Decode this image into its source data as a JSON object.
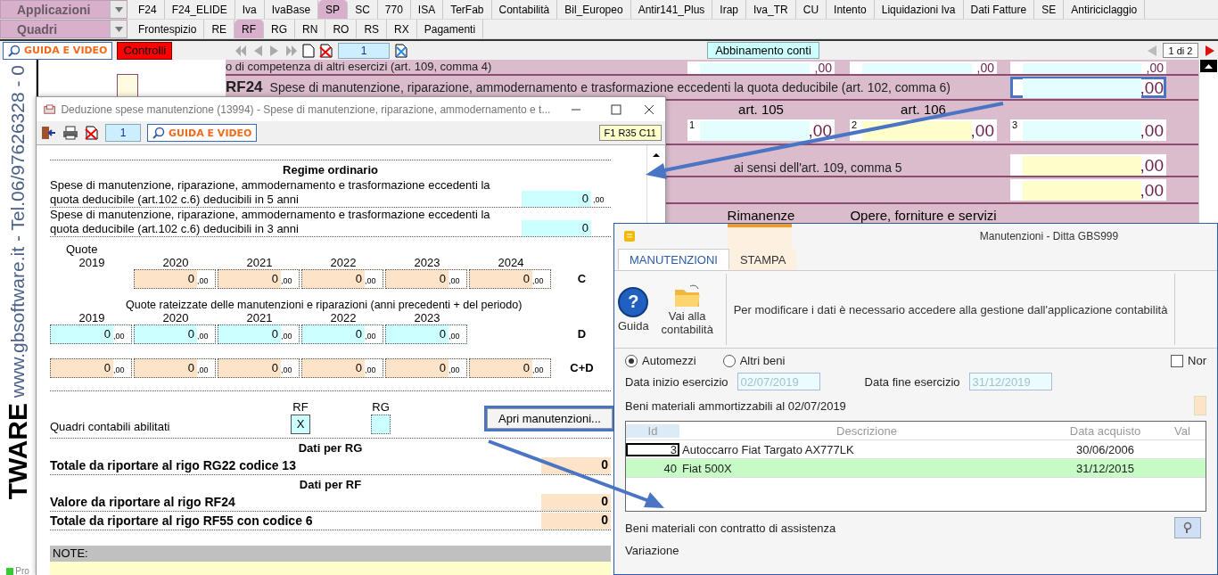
{
  "menu": {
    "applications_label": "Applicazioni",
    "applications": [
      {
        "label": "F24",
        "selected": false
      },
      {
        "label": "F24_ELIDE",
        "selected": false
      },
      {
        "label": "Iva",
        "selected": false
      },
      {
        "label": "IvaBase",
        "selected": false
      },
      {
        "label": "SP",
        "selected": true
      },
      {
        "label": "SC",
        "selected": false
      },
      {
        "label": "770",
        "selected": false
      },
      {
        "label": "ISA",
        "selected": false
      },
      {
        "label": "TerFab",
        "selected": false
      },
      {
        "label": "Contabilità",
        "selected": false
      },
      {
        "label": "Bil_Europeo",
        "selected": false
      },
      {
        "label": "Antir141_Plus",
        "selected": false
      },
      {
        "label": "Irap",
        "selected": false
      },
      {
        "label": "Iva_TR",
        "selected": false
      },
      {
        "label": "CU",
        "selected": false
      },
      {
        "label": "Intento",
        "selected": false
      },
      {
        "label": "Liquidazioni Iva",
        "selected": false
      },
      {
        "label": "Dati Fatture",
        "selected": false
      },
      {
        "label": "SE",
        "selected": false
      },
      {
        "label": "Antiriciclaggio",
        "selected": false
      }
    ],
    "sections_label": "Quadri",
    "sections": [
      {
        "label": "Frontespizio",
        "selected": false
      },
      {
        "label": "RE",
        "selected": false
      },
      {
        "label": "RF",
        "selected": true
      },
      {
        "label": "RG",
        "selected": false
      },
      {
        "label": "RN",
        "selected": false
      },
      {
        "label": "RO",
        "selected": false
      },
      {
        "label": "RS",
        "selected": false
      },
      {
        "label": "RX",
        "selected": false
      },
      {
        "label": "Pagamenti",
        "selected": false
      }
    ]
  },
  "toolbar": {
    "guide_button": "GUIDA E VIDEO",
    "checks_button": "Controlli",
    "page": "1",
    "match_button": "Abbinamento conti",
    "page_count": "1 di 2"
  },
  "sidebar": {
    "banner": "www.gbsoftware.it - Tel.06/97626328 - 0",
    "brand": "TWARE",
    "status": "Pro"
  },
  "form": {
    "top_line": "o di competenza di altri esercizi (art. 109, comma 4)",
    "top_fields": [
      {
        "value": ",00",
        "kind": "input"
      },
      {
        "value": ",00",
        "kind": "input"
      },
      {
        "value": ",00",
        "kind": "input"
      }
    ],
    "rf24_code": "RF24",
    "rf24_text": "Spese di manutenzione, riparazione, ammodernamento e trasformazione eccedenti la quota deducibile (art. 102, comma 6)",
    "rf24_field": {
      "value": ",00",
      "kind": "input"
    },
    "art_labels": [
      "art. 105",
      "art. 106"
    ],
    "art_fields": [
      {
        "index": "1",
        "value": ",00",
        "kind": "input"
      },
      {
        "index": "2",
        "value": ",00",
        "kind": "calculated"
      },
      {
        "index": "3",
        "value": ",00",
        "kind": "input"
      }
    ],
    "comma5_text": "ai sensi dell'art. 109, comma 5",
    "comma5_fields": [
      {
        "value": ",00",
        "kind": "calculated"
      },
      {
        "value": ",00",
        "kind": "calculated"
      }
    ],
    "bottom_labels": [
      "Rimanenze",
      "Opere, forniture e servizi"
    ]
  },
  "deduction_window": {
    "title": "Deduzione spese manutenzione (13994) - Spese di manutenzione, riparazione, ammodernamento e t...",
    "page": "1",
    "guide_button": "GUIDA E VIDEO",
    "cell_ref": "F1 R35 C11",
    "heading": "Regime ordinario",
    "amount_rows": [
      {
        "label": "Spese di manutenzione, riparazione, ammodernamento e trasformazione eccedenti la quota deducibile (art.102 c.6) deducibili in 5 anni",
        "value": "0",
        "decimals": ",00"
      },
      {
        "label": "Spese di manutenzione, riparazione, ammodernamento e trasformazione eccedenti la quota deducibile (art.102 c.6) deducibili in 3 anni",
        "value": "0"
      }
    ],
    "quote_label": "Quote",
    "c_years": [
      "2019",
      "2020",
      "2021",
      "2022",
      "2023",
      "2024"
    ],
    "c_row": {
      "label": "C",
      "kind": "computed",
      "cells": [
        {
          "value": "0",
          "decimals": ",00"
        },
        {
          "value": "0",
          "decimals": ",00"
        },
        {
          "value": "0",
          "decimals": ",00"
        },
        {
          "value": "0",
          "decimals": ",00"
        },
        {
          "value": "0",
          "decimals": ",00"
        }
      ]
    },
    "rate_title": "Quote rateizzate delle manutenzioni e riparazioni (anni precedenti + del periodo)",
    "d_years": [
      "2019",
      "2020",
      "2021",
      "2022",
      "2023"
    ],
    "d_row": {
      "label": "D",
      "kind": "input",
      "cells": [
        {
          "value": "0",
          "decimals": ",00"
        },
        {
          "value": "0",
          "decimals": ",00"
        },
        {
          "value": "0",
          "decimals": ",00"
        },
        {
          "value": "0",
          "decimals": ",00"
        },
        {
          "value": "0",
          "decimals": ",00"
        }
      ]
    },
    "cd_row": {
      "label": "C+D",
      "kind": "computed",
      "cells": [
        {
          "value": "0",
          "decimals": ",00"
        },
        {
          "value": "0",
          "decimals": ",00"
        },
        {
          "value": "0",
          "decimals": ",00"
        },
        {
          "value": "0",
          "decimals": ",00"
        },
        {
          "value": "0",
          "decimals": ",00"
        },
        {
          "value": "0",
          "decimals": ",00"
        }
      ]
    },
    "enabled_label": "Quadri contabili abilitati",
    "enabled": [
      {
        "label": "RF",
        "checked": true,
        "mark": "X"
      },
      {
        "label": "RG",
        "checked": false
      }
    ],
    "open_button": "Apri manutenzioni...",
    "rg_heading": "Dati per RG",
    "rg_totals": [
      {
        "label": "Totale da riportare al rigo RG22 codice 13",
        "value": "0"
      }
    ],
    "rf_heading": "Dati per RF",
    "rf_totals": [
      {
        "label": "Valore da riportare al rigo RF24",
        "value": "0"
      },
      {
        "label": "Totale da riportare al rigo RF55 con codice 6",
        "value": "0"
      }
    ],
    "notes_label": "NOTE:"
  },
  "maintenance_window": {
    "title": "Manutenzioni - Ditta GBS999",
    "tabs": [
      {
        "label": "MANUTENZIONI",
        "selected": true
      },
      {
        "label": "STAMPA",
        "selected": false
      }
    ],
    "ribbon": [
      {
        "label": "Guida",
        "kind": "help",
        "icon": "?"
      },
      {
        "label": "Vai alla contabilità",
        "kind": "folder"
      }
    ],
    "message": "Per modificare i dati è necessario accedere alla gestione dall'applicazione contabilità",
    "asset_types": [
      {
        "label": "Automezzi",
        "selected": true
      },
      {
        "label": "Altri beni",
        "selected": false
      }
    ],
    "option": {
      "label": "Nor",
      "checked": false
    },
    "start_label": "Data inizio esercizio",
    "start_value": "02/07/2019",
    "end_label": "Data fine esercizio",
    "end_value": "31/12/2019",
    "assets_label": "Beni materiali ammortizzabili al 02/07/2019",
    "table": {
      "columns": [
        "Id",
        "Descrizione",
        "Data acquisto",
        "Val"
      ],
      "rows": [
        {
          "cells": [
            "3",
            "Autoccarro Fiat Targato AX777LK",
            "30/06/2006"
          ],
          "selected": false
        },
        {
          "cells": [
            "40",
            "Fiat 500X",
            "31/12/2015"
          ],
          "selected": true
        }
      ]
    },
    "service_label": "Beni materiali con contratto di assistenza",
    "change_label": "Variazione"
  }
}
